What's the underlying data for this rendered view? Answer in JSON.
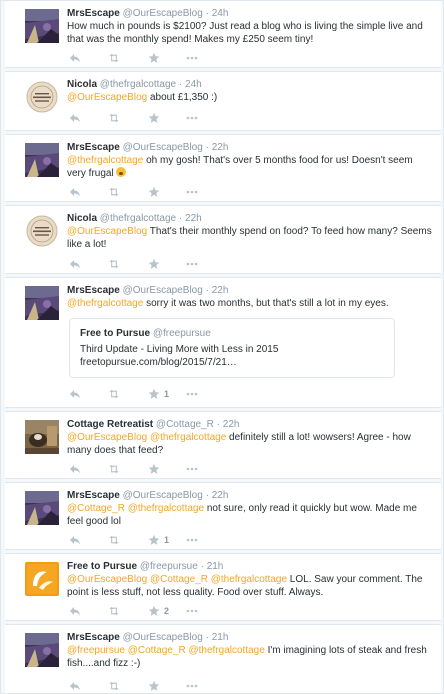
{
  "colors": {
    "mention": "#f5a623",
    "name": "#292f33",
    "meta": "#8899a6",
    "action": "#b8c4cc",
    "border": "#e1e8ed"
  },
  "icons": [
    "reply-icon",
    "retweet-icon",
    "favorite-icon",
    "more-icon",
    "face-screaming-emoji"
  ],
  "tweets": [
    {
      "name": "MrsEscape",
      "handle": "@OurEscapeBlog",
      "sep": "·",
      "time": "24h",
      "avatar": "mrsescape",
      "text": [
        {
          "t": "How much in pounds is $2100? Just read a blog who is living the simple live and that was the monthly spend! Makes my £250 seem tiny!"
        }
      ]
    },
    {
      "name": "Nicola",
      "handle": "@thefrgalcottage",
      "sep": "·",
      "time": "24h",
      "avatar": "nicola",
      "text": [
        {
          "t": "@OurEscapeBlog",
          "m": true
        },
        {
          "t": " about £1,350 :)"
        }
      ]
    },
    {
      "name": "MrsEscape",
      "handle": "@OurEscapeBlog",
      "sep": "·",
      "time": "22h",
      "avatar": "mrsescape",
      "text": [
        {
          "t": "@thefrgalcottage",
          "m": true
        },
        {
          "t": " oh my gosh! That's over 5 months food for us! Doesn't seem very frugal "
        },
        {
          "emoji": true
        }
      ]
    },
    {
      "name": "Nicola",
      "handle": "@thefrgalcottage",
      "sep": "·",
      "time": "22h",
      "avatar": "nicola",
      "text": [
        {
          "t": "@OurEscapeBlog",
          "m": true
        },
        {
          "t": " That's their monthly spend on food? To feed how many? Seems like a lot!"
        }
      ]
    },
    {
      "name": "MrsEscape",
      "handle": "@OurEscapeBlog",
      "sep": "·",
      "time": "22h",
      "avatar": "mrsescape",
      "text": [
        {
          "t": "@thefrgalcottage",
          "m": true
        },
        {
          "t": " sorry it was two months, but that's still a lot in my eyes."
        }
      ],
      "card": {
        "name": "Free to Pursue",
        "handle": "@freepursue",
        "title": "Third Update - Living More with Less in 2015",
        "url": "freetopursue.com/blog/2015/7/21…"
      },
      "fav_count": "1"
    },
    {
      "name": "Cottage Retreatist",
      "handle": "@Cottage_R",
      "sep": "·",
      "time": "22h",
      "avatar": "cottage",
      "text": [
        {
          "t": "@OurEscapeBlog @thefrgalcottage",
          "m": true
        },
        {
          "t": " definitely still a lot! wowsers! Agree - how many does that feed?"
        }
      ]
    },
    {
      "name": "MrsEscape",
      "handle": "@OurEscapeBlog",
      "sep": "·",
      "time": "22h",
      "avatar": "mrsescape",
      "text": [
        {
          "t": "@Cottage_R @thefrgalcottage",
          "m": true
        },
        {
          "t": " not sure, only read it quickly but wow. Made me feel good lol"
        }
      ],
      "fav_count": "1"
    },
    {
      "name": "Free to Pursue",
      "handle": "@freepursue",
      "sep": "·",
      "time": "21h",
      "avatar": "free",
      "text": [
        {
          "t": "@OurEscapeBlog @Cottage_R @thefrgalcottage",
          "m": true
        },
        {
          "t": " LOL. Saw your comment. The point is less stuff, not less quality. Food over stuff. Always."
        }
      ],
      "fav_count": "2"
    },
    {
      "name": "MrsEscape",
      "handle": "@OurEscapeBlog",
      "sep": "·",
      "time": "21h",
      "avatar": "mrsescape",
      "text": [
        {
          "t": "@freepursue @Cottage_R @thefrgalcottage",
          "m": true
        },
        {
          "t": " I'm imagining lots of steak and fresh fish....and fizz :-)"
        }
      ]
    }
  ]
}
